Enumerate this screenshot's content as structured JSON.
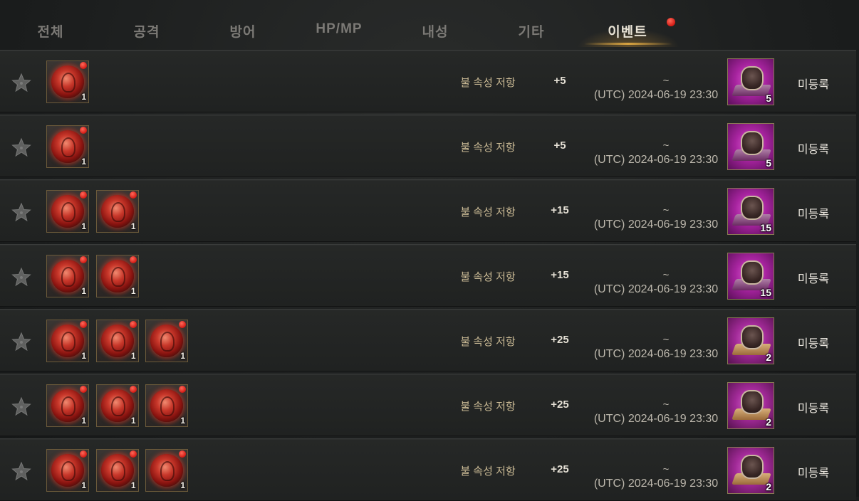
{
  "tabs": [
    {
      "label": "전체",
      "active": false
    },
    {
      "label": "공격",
      "active": false
    },
    {
      "label": "방어",
      "active": false
    },
    {
      "label": "HP/MP",
      "active": false
    },
    {
      "label": "내성",
      "active": false
    },
    {
      "label": "기타",
      "active": false
    },
    {
      "label": "이벤트",
      "active": true,
      "notification": true
    }
  ],
  "colors": {
    "accent": "#d9a441",
    "notification": "#d41a14",
    "stat_text": "#c9b994"
  },
  "rows": [
    {
      "materials": [
        {
          "icon": "fire-orb-icon",
          "count": "1"
        }
      ],
      "stat_name": "불 속성 저항",
      "stat_value": "+5",
      "period_tilde": "~",
      "period_end": "(UTC) 2024-06-19 23:30",
      "reward": {
        "icon": "charm-icon",
        "count": "5"
      },
      "status": "미등록"
    },
    {
      "materials": [
        {
          "icon": "fire-orb-icon",
          "count": "1"
        }
      ],
      "stat_name": "불 속성 저항",
      "stat_value": "+5",
      "period_tilde": "~",
      "period_end": "(UTC) 2024-06-19 23:30",
      "reward": {
        "icon": "charm-icon",
        "count": "5"
      },
      "status": "미등록"
    },
    {
      "materials": [
        {
          "icon": "fire-orb-icon",
          "count": "1"
        },
        {
          "icon": "fire-orb-icon",
          "count": "1"
        }
      ],
      "stat_name": "불 속성 저항",
      "stat_value": "+15",
      "period_tilde": "~",
      "period_end": "(UTC) 2024-06-19 23:30",
      "reward": {
        "icon": "charm-icon",
        "count": "15"
      },
      "status": "미등록"
    },
    {
      "materials": [
        {
          "icon": "fire-orb-icon",
          "count": "1"
        },
        {
          "icon": "fire-orb-icon",
          "count": "1"
        }
      ],
      "stat_name": "불 속성 저항",
      "stat_value": "+15",
      "period_tilde": "~",
      "period_end": "(UTC) 2024-06-19 23:30",
      "reward": {
        "icon": "charm-icon",
        "count": "15"
      },
      "status": "미등록"
    },
    {
      "materials": [
        {
          "icon": "fire-orb-icon",
          "count": "1"
        },
        {
          "icon": "fire-orb-icon",
          "count": "1"
        },
        {
          "icon": "fire-orb-icon",
          "count": "1"
        }
      ],
      "stat_name": "불 속성 저항",
      "stat_value": "+25",
      "period_tilde": "~",
      "period_end": "(UTC) 2024-06-19 23:30",
      "reward": {
        "icon": "charm-scroll-icon",
        "count": "2"
      },
      "status": "미등록"
    },
    {
      "materials": [
        {
          "icon": "fire-orb-icon",
          "count": "1"
        },
        {
          "icon": "fire-orb-icon",
          "count": "1"
        },
        {
          "icon": "fire-orb-icon",
          "count": "1"
        }
      ],
      "stat_name": "불 속성 저항",
      "stat_value": "+25",
      "period_tilde": "~",
      "period_end": "(UTC) 2024-06-19 23:30",
      "reward": {
        "icon": "charm-scroll-icon",
        "count": "2"
      },
      "status": "미등록"
    },
    {
      "materials": [
        {
          "icon": "fire-orb-icon",
          "count": "1"
        },
        {
          "icon": "fire-orb-icon",
          "count": "1"
        },
        {
          "icon": "fire-orb-icon",
          "count": "1"
        }
      ],
      "stat_name": "불 속성 저항",
      "stat_value": "+25",
      "period_tilde": "~",
      "period_end": "(UTC) 2024-06-19 23:30",
      "reward": {
        "icon": "charm-scroll-icon",
        "count": "2"
      },
      "status": "미등록"
    }
  ]
}
